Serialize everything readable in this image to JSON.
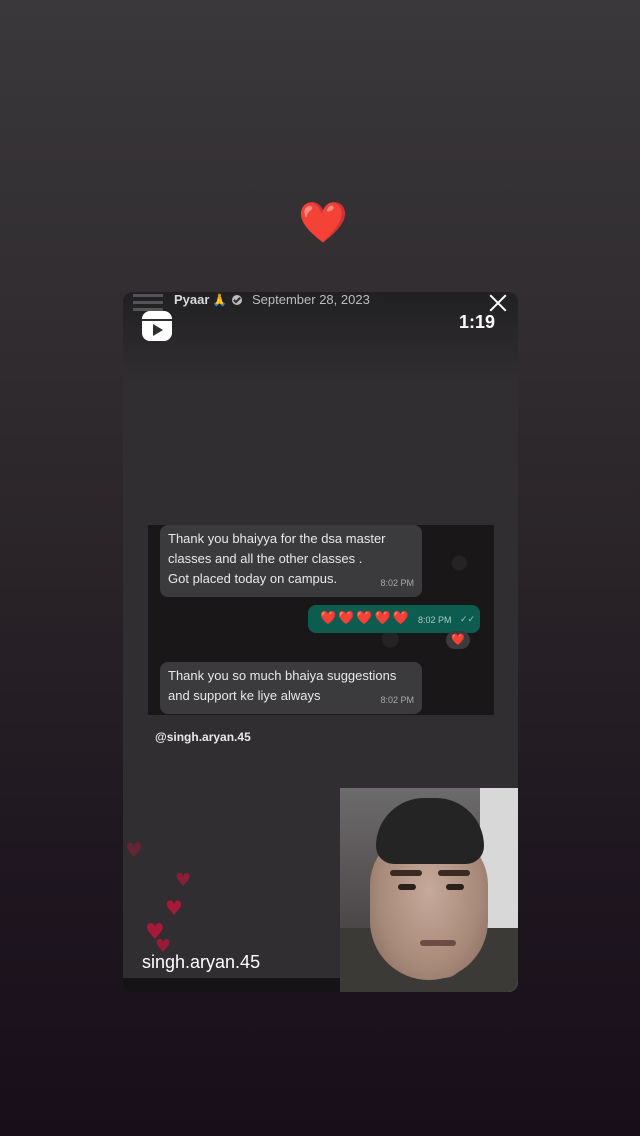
{
  "story": {
    "reaction_emoji": "❤️"
  },
  "reel": {
    "author": "Pyaar",
    "author_emoji": "🙏",
    "date": "September 28, 2023",
    "timer": "1:19",
    "mention": "@singh.aryan.45",
    "username": "singh.aryan.45",
    "icons": [
      "reels-icon",
      "close-icon",
      "verified-badge-icon"
    ]
  },
  "chat": {
    "messages": [
      {
        "text": "Thank you bhaiyya for the dsa master classes and all the other classes .\nGot placed today on campus.",
        "time": "8:02 PM"
      },
      {
        "text": "❤️❤️❤️❤️❤️",
        "time": "8:02 PM",
        "reaction": "❤️"
      },
      {
        "text": "Thank you so much bhaiya suggestions and support ke liye always",
        "time": "8:02 PM"
      }
    ]
  },
  "colors": {
    "heart": "#e0202a",
    "outgoing_bubble": "#0c5c4f",
    "incoming_bubble": "#3b3b3d"
  }
}
